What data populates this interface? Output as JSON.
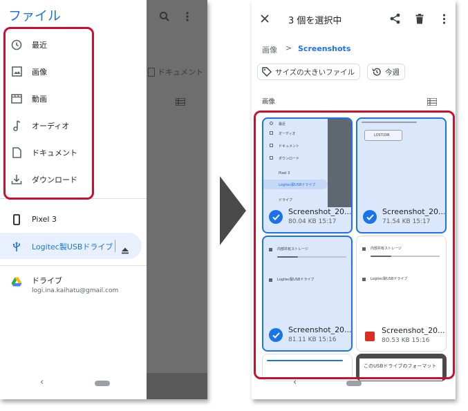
{
  "left": {
    "drawer_title": "ファイル",
    "menu": [
      {
        "label": "最近",
        "icon": "clock-icon"
      },
      {
        "label": "画像",
        "icon": "image-icon"
      },
      {
        "label": "動画",
        "icon": "video-icon"
      },
      {
        "label": "オーディオ",
        "icon": "music-note-icon"
      },
      {
        "label": "ドキュメント",
        "icon": "document-icon"
      },
      {
        "label": "ダウンロード",
        "icon": "download-icon"
      }
    ],
    "devices": {
      "pixel": "Pixel 3",
      "usb": "Logitec製USBドライブ",
      "drive": "ドライブ",
      "drive_account": "logi.ina.kaihatu@gmail.com"
    },
    "background_folder": "ドキュメント"
  },
  "right": {
    "title": "3 個を選択中",
    "breadcrumb": {
      "root": "画像",
      "separator": ">",
      "current": "Screenshots"
    },
    "chips": [
      {
        "label": "サイズの大きいファイル",
        "icon": "tag-icon"
      },
      {
        "label": "今週",
        "icon": "history-icon"
      }
    ],
    "section_label": "画像",
    "files": [
      {
        "name": "Screenshot_20...",
        "meta": "80.04 KB 15:17",
        "selected": true
      },
      {
        "name": "Screenshot_20...",
        "meta": "71.54 KB 15:17",
        "selected": true
      },
      {
        "name": "Screenshot_20...",
        "meta": "81.11 KB 15:16",
        "selected": true
      },
      {
        "name": "Screenshot_20...",
        "meta": "80.53 KB 15:16",
        "selected": false
      }
    ],
    "thumb_texts": {
      "t1": [
        "最近",
        "オーディオ",
        "ドキュメント",
        "ダウンロード",
        "Pixel 3",
        "Logitec製USBドライブ",
        "ドライブ"
      ],
      "t2": [
        "LOST.DIR"
      ],
      "t3": [
        "内部共有ストレージ",
        "Logitec製USBドライブ"
      ],
      "t4": [
        "内部共有ストレージ",
        "Logitec製USBドライブ"
      ],
      "t6": "このUSBドライブのフォーマット"
    }
  }
}
